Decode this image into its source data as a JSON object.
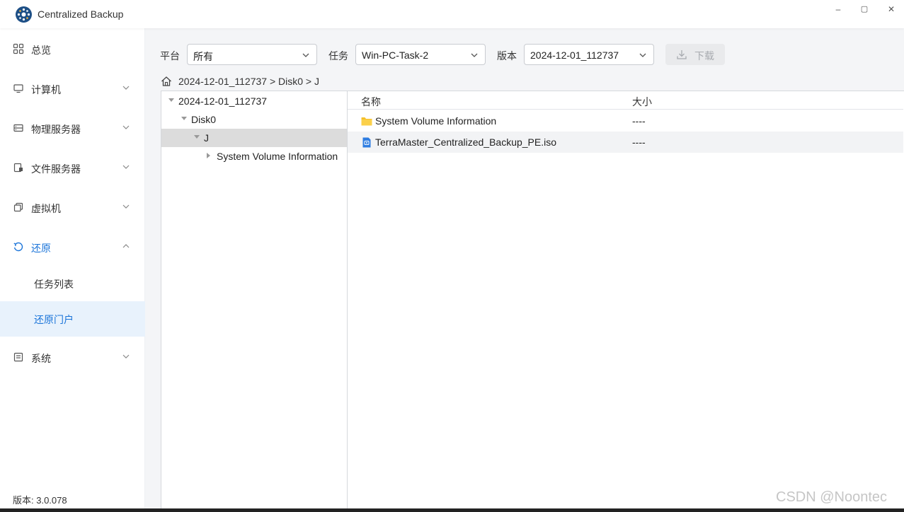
{
  "window": {
    "title": "Centralized Backup",
    "controls": [
      "–",
      "▢",
      "✕"
    ]
  },
  "sidebar": {
    "items": [
      {
        "label": "总览",
        "icon": "dashboard-icon"
      },
      {
        "label": "计算机",
        "icon": "monitor-icon"
      },
      {
        "label": "物理服务器",
        "icon": "server-icon"
      },
      {
        "label": "文件服务器",
        "icon": "file-server-icon"
      },
      {
        "label": "虚拟机",
        "icon": "virtual-machine-icon"
      },
      {
        "label": "还原",
        "icon": "restore-icon"
      },
      {
        "label": "系统",
        "icon": "system-icon"
      }
    ],
    "restore_subitems": [
      {
        "label": "任务列表"
      },
      {
        "label": "还原门户"
      }
    ],
    "version": "版本: 3.0.078",
    "accent_color": "#1a74d9"
  },
  "filters": {
    "platform": {
      "label": "平台",
      "value": "所有"
    },
    "task": {
      "label": "任务",
      "value": "Win-PC-Task-2"
    },
    "version": {
      "label": "版本",
      "value": "2024-12-01_112737"
    },
    "download_label": "下载"
  },
  "breadcrumb": "2024-12-01_112737 > Disk0 > J",
  "tree": [
    {
      "label": "2024-12-01_112737",
      "expanded": true
    },
    {
      "label": "Disk0",
      "expanded": true
    },
    {
      "label": "J",
      "expanded": true,
      "selected": true
    },
    {
      "label": "System Volume Information",
      "expanded": false
    }
  ],
  "file_list": {
    "columns": {
      "name": "名称",
      "size": "大小"
    },
    "rows": [
      {
        "name": "System Volume Information",
        "size": "----",
        "icon": "folder-icon"
      },
      {
        "name": "TerraMaster_Centralized_Backup_PE.iso",
        "size": "----",
        "icon": "disc-image-icon"
      }
    ]
  },
  "watermark": "CSDN @Noontec"
}
